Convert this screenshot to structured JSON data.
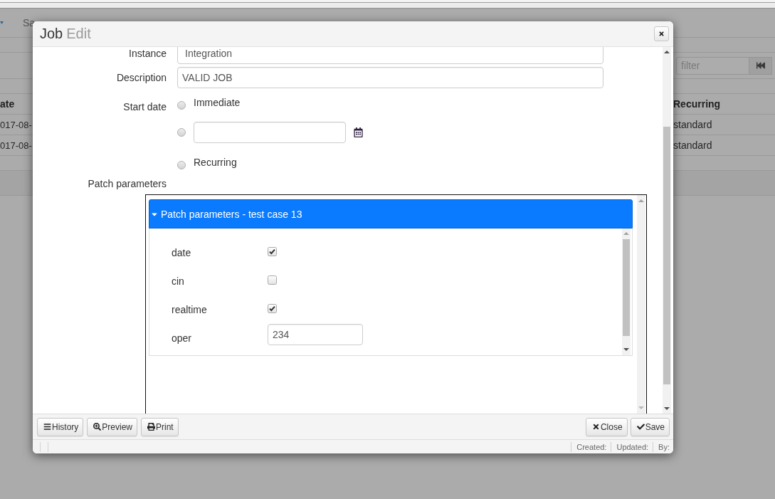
{
  "background_page": {
    "nav": {
      "item": "Sa"
    },
    "filter": {
      "placeholder": "filter"
    },
    "table": {
      "columns": [
        "ate",
        "Recurring"
      ],
      "rows": [
        [
          "017-08-",
          "standard"
        ],
        [
          "017-08-",
          "standard"
        ]
      ]
    }
  },
  "dialog": {
    "title": "Job",
    "subtitle": "Edit",
    "form": {
      "instance": {
        "label": "Instance",
        "value": "Integration"
      },
      "description": {
        "label": "Description",
        "value": "VALID JOB"
      },
      "start_date": {
        "label": "Start date",
        "options": [
          {
            "kind": "text",
            "label": "Immediate",
            "selected": false
          },
          {
            "kind": "date",
            "selected": false
          },
          {
            "kind": "text",
            "label": "Recurring",
            "selected": false
          }
        ]
      }
    },
    "patch_parameters": {
      "label": "Patch parameters",
      "panel": {
        "title": "Patch parameters - test case 13",
        "expanded": true,
        "fields": [
          {
            "kind": "checkbox",
            "label": "date",
            "checked": true
          },
          {
            "kind": "checkbox",
            "label": "cin",
            "checked": false
          },
          {
            "kind": "checkbox",
            "label": "realtime",
            "checked": true
          },
          {
            "kind": "text",
            "label": "oper",
            "value": "234"
          }
        ]
      }
    },
    "footer": {
      "left_buttons": [
        {
          "kind": "history",
          "label": "History"
        },
        {
          "kind": "preview",
          "label": "Preview"
        },
        {
          "kind": "print",
          "label": "Print"
        }
      ],
      "right_buttons": [
        {
          "kind": "close",
          "label": "Close"
        },
        {
          "kind": "save",
          "label": "Save"
        }
      ]
    },
    "status_bar": [
      "Created:",
      "Updated:",
      "By:"
    ]
  }
}
